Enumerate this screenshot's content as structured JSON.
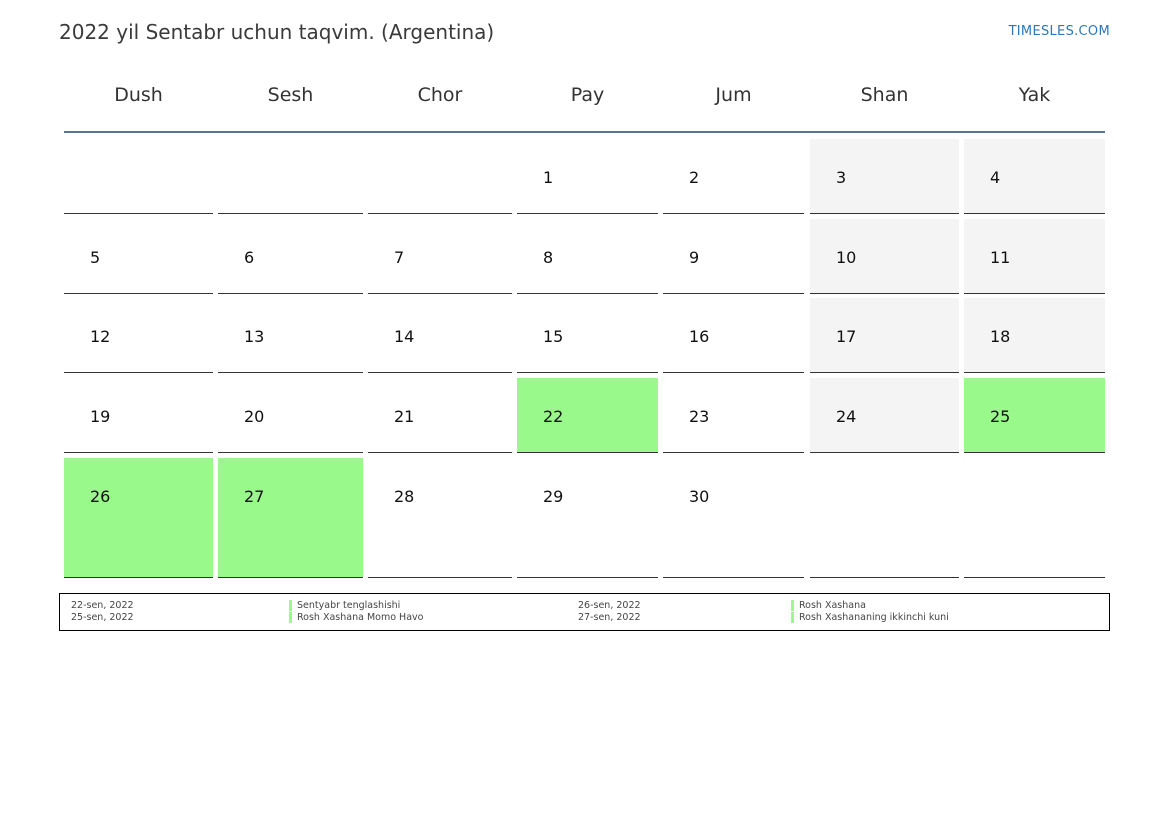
{
  "header": {
    "title": "2022 yil Sentabr uchun taqvim. (Argentina)",
    "brand": "TIMESLES.COM"
  },
  "weekdays": [
    "Dush",
    "Sesh",
    "Chor",
    "Pay",
    "Jum",
    "Shan",
    "Yak"
  ],
  "weeks": [
    [
      null,
      null,
      null,
      1,
      2,
      3,
      4
    ],
    [
      5,
      6,
      7,
      8,
      9,
      10,
      11
    ],
    [
      12,
      13,
      14,
      15,
      16,
      17,
      18
    ],
    [
      19,
      20,
      21,
      22,
      23,
      24,
      25
    ],
    [
      26,
      27,
      28,
      29,
      30,
      null,
      null
    ]
  ],
  "holiday_days": [
    22,
    25,
    26,
    27
  ],
  "colors": {
    "holiday": "#99f98a",
    "weekend": "#f4f4f4",
    "header_rule": "#5b7595",
    "brand": "#2f77b8"
  },
  "legend": [
    {
      "date": "22-sen, 2022",
      "name": "Sentyabr tenglashishi"
    },
    {
      "date": "25-sen, 2022",
      "name": "Rosh Xashana Momo Havo"
    },
    {
      "date": "26-sen, 2022",
      "name": "Rosh Xashana"
    },
    {
      "date": "27-sen, 2022",
      "name": "Rosh Xashananing ikkinchi kuni"
    }
  ]
}
